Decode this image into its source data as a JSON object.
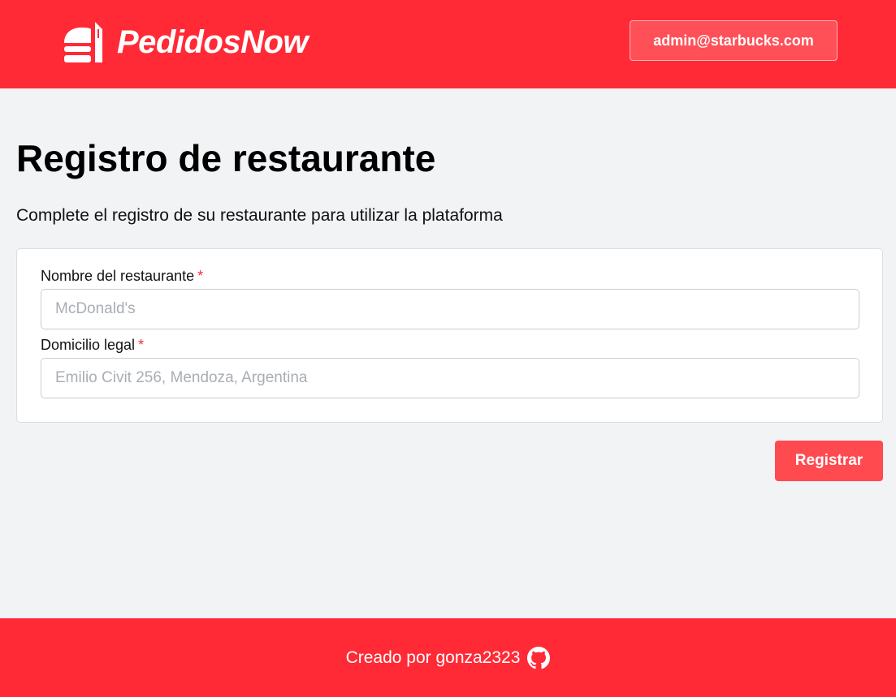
{
  "header": {
    "brand_name": "PedidosNow",
    "logo_icon": "food-stack-icon",
    "user_email": "admin@starbucks.com"
  },
  "main": {
    "title": "Registro de restaurante",
    "subtitle": "Complete el registro de su restaurante para utilizar la plataforma",
    "form": {
      "fields": [
        {
          "label": "Nombre del restaurante",
          "required_mark": "*",
          "value": "",
          "placeholder": "McDonald's"
        },
        {
          "label": "Domicilio legal",
          "required_mark": "*",
          "value": "",
          "placeholder": "Emilio Civit 256, Mendoza, Argentina"
        }
      ],
      "submit_label": "Registrar"
    }
  },
  "footer": {
    "credit_text": "Creado por gonza2323",
    "github_icon": "github-icon"
  },
  "colors": {
    "brand_red": "#ff2a36",
    "button_red": "#ff4a50",
    "background": "#f2f3f5",
    "placeholder": "#a9aeb5"
  }
}
